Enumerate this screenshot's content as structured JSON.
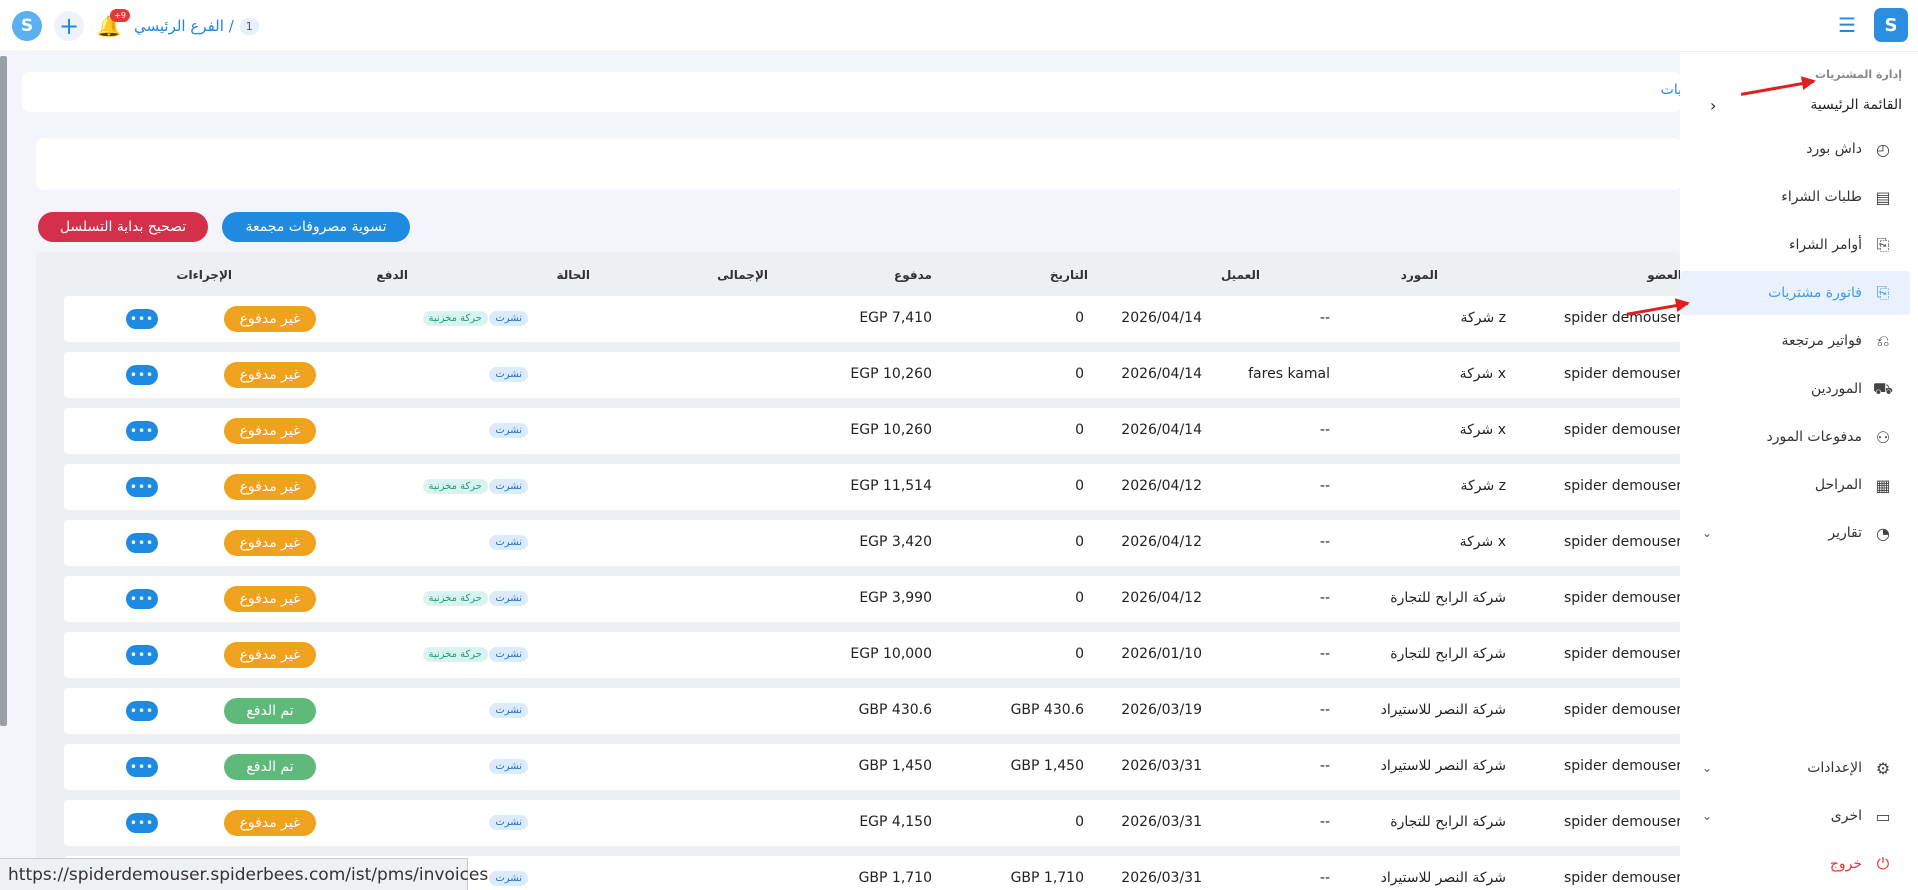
{
  "topbar": {
    "branch_number": "1",
    "branch_name": "الفرع الرئيسي /",
    "notification_count": "+9"
  },
  "sidebar": {
    "section_title": "إدارة المشتريات",
    "back_label": "القائمة الرئيسية",
    "items": [
      {
        "label": "داش بورد",
        "icon": "dashboard-icon"
      },
      {
        "label": "طلبات الشراء",
        "icon": "purchase-requests-icon"
      },
      {
        "label": "أوامر الشراء",
        "icon": "purchase-orders-icon"
      },
      {
        "label": "فاتورة مشتريات",
        "icon": "purchase-invoice-icon",
        "active": true
      },
      {
        "label": "فواتير مرتجعة",
        "icon": "returned-invoices-icon"
      },
      {
        "label": "الموردين",
        "icon": "suppliers-icon"
      },
      {
        "label": "مدفوعات المورد",
        "icon": "supplier-payments-icon"
      },
      {
        "label": "المراحل",
        "icon": "stages-icon"
      },
      {
        "label": "تقارير",
        "icon": "reports-icon"
      }
    ],
    "bottom": [
      {
        "label": "الإعدادات",
        "icon": "gear-icon"
      },
      {
        "label": "اخرى",
        "icon": "other-icon"
      },
      {
        "label": "خروج",
        "icon": "power-icon"
      }
    ]
  },
  "breadcrumb": "يات",
  "actions": {
    "fix_sequence": "تصحيح بداية التسلسل",
    "bulk_expense": "تسوية مصروفات مجمعة"
  },
  "table": {
    "headers": {
      "member": "العضو",
      "supplier": "المورد",
      "client": "العميل",
      "date": "التاريخ",
      "paid": "مدفوع",
      "total": "الإجمالى",
      "status": "الحالة",
      "payment": "الدفع",
      "actions": "الإجراءات"
    },
    "rows": [
      {
        "member": "spider demouser",
        "supplier": "شركة z",
        "client": "--",
        "date": "2026/04/14",
        "paid": "0",
        "total": "EGP 7,410",
        "published": "نشرت",
        "inventory": "حركة مخزنية",
        "payment": "غير مدفوع",
        "payment_state": "unpaid"
      },
      {
        "member": "spider demouser",
        "supplier": "شركة x",
        "client": "fares kamal",
        "date": "2026/04/14",
        "paid": "0",
        "total": "EGP 10,260",
        "published": "نشرت",
        "inventory": "",
        "payment": "غير مدفوع",
        "payment_state": "unpaid"
      },
      {
        "member": "spider demouser",
        "supplier": "شركة x",
        "client": "--",
        "date": "2026/04/14",
        "paid": "0",
        "total": "EGP 10,260",
        "published": "نشرت",
        "inventory": "",
        "payment": "غير مدفوع",
        "payment_state": "unpaid"
      },
      {
        "member": "spider demouser",
        "supplier": "شركة z",
        "client": "--",
        "date": "2026/04/12",
        "paid": "0",
        "total": "EGP 11,514",
        "published": "نشرت",
        "inventory": "حركة مخزنية",
        "payment": "غير مدفوع",
        "payment_state": "unpaid"
      },
      {
        "member": "spider demouser",
        "supplier": "شركة x",
        "client": "--",
        "date": "2026/04/12",
        "paid": "0",
        "total": "EGP 3,420",
        "published": "نشرت",
        "inventory": "",
        "payment": "غير مدفوع",
        "payment_state": "unpaid"
      },
      {
        "member": "spider demouser",
        "supplier": "شركة الرابح للتجارة",
        "client": "--",
        "date": "2026/04/12",
        "paid": "0",
        "total": "EGP 3,990",
        "published": "نشرت",
        "inventory": "حركة مخزنية",
        "payment": "غير مدفوع",
        "payment_state": "unpaid"
      },
      {
        "member": "spider demouser",
        "supplier": "شركة الرابح للتجارة",
        "client": "--",
        "date": "2026/01/10",
        "paid": "0",
        "total": "EGP 10,000",
        "published": "نشرت",
        "inventory": "حركة مخزنية",
        "payment": "غير مدفوع",
        "payment_state": "unpaid"
      },
      {
        "member": "spider demouser",
        "supplier": "شركة النصر للاستيراد",
        "client": "--",
        "date": "2026/03/19",
        "paid": "GBP 430.6",
        "total": "GBP 430.6",
        "published": "نشرت",
        "inventory": "",
        "payment": "تم الدفع",
        "payment_state": "paid"
      },
      {
        "member": "spider demouser",
        "supplier": "شركة النصر للاستيراد",
        "client": "--",
        "date": "2026/03/31",
        "paid": "GBP 1,450",
        "total": "GBP 1,450",
        "published": "نشرت",
        "inventory": "",
        "payment": "تم الدفع",
        "payment_state": "paid"
      },
      {
        "member": "spider demouser",
        "supplier": "شركة الرابح للتجارة",
        "client": "--",
        "date": "2026/03/31",
        "paid": "0",
        "total": "EGP 4,150",
        "published": "نشرت",
        "inventory": "",
        "payment": "غير مدفوع",
        "payment_state": "unpaid"
      },
      {
        "member": "spider demouser",
        "supplier": "شركة النصر للاستيراد",
        "client": "--",
        "date": "2026/03/31",
        "paid": "GBP 1,710",
        "total": "GBP 1,710",
        "published": "نشرت",
        "inventory": "",
        "payment": "",
        "payment_state": "hidden"
      }
    ]
  },
  "status_bar_url": "https://spiderdemouser.spiderbees.com/ist/pms/invoices",
  "colors": {
    "primary": "#1f8be0",
    "danger": "#d4304c",
    "unpaid": "#f0a11e",
    "paid": "#5fb97b",
    "active_bg": "#e9f2fc"
  }
}
